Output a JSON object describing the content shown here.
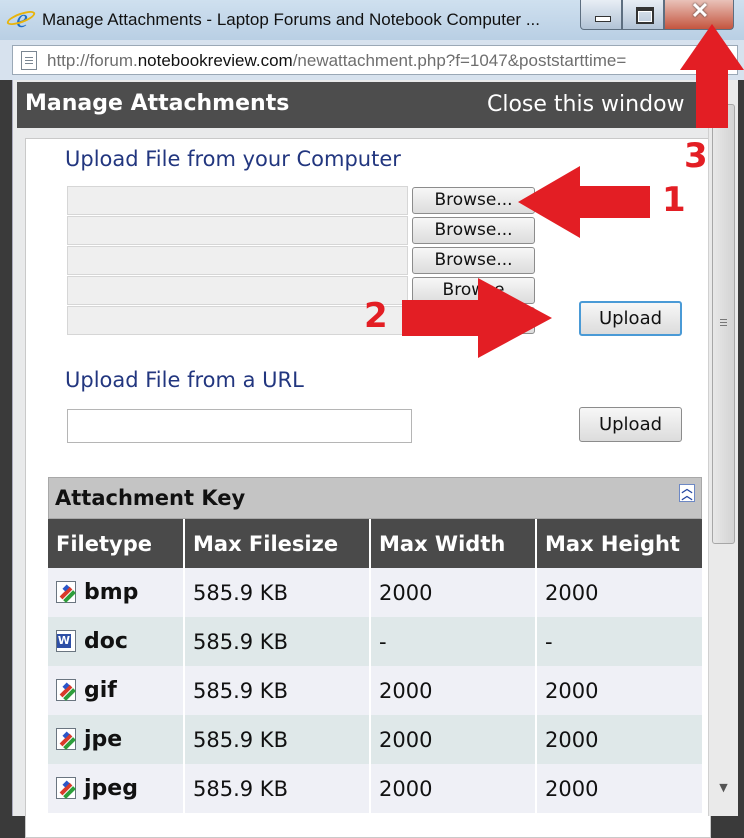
{
  "window": {
    "title": "Manage Attachments - Laptop Forums and Notebook Computer ...",
    "url_prefix": "http://forum.",
    "url_domain": "notebookreview.com",
    "url_suffix": "/newattachment.php?f=1047&poststarttime="
  },
  "header": {
    "title": "Manage Attachments",
    "close_label": "Close this window"
  },
  "upload_computer": {
    "heading": "Upload File from your Computer",
    "browse_label": "Browse...",
    "browse_partial_label": "Browse",
    "upload_label": "Upload"
  },
  "upload_url": {
    "heading": "Upload File from a URL",
    "upload_label": "Upload"
  },
  "attachment_key": {
    "title": "Attachment Key",
    "columns": [
      "Filetype",
      "Max Filesize",
      "Max Width",
      "Max Height"
    ],
    "rows": [
      {
        "icon": "image-file-icon",
        "ext": "bmp",
        "size": "585.9 KB",
        "width": "2000",
        "height": "2000"
      },
      {
        "icon": "word-file-icon",
        "ext": "doc",
        "size": "585.9 KB",
        "width": "-",
        "height": "-"
      },
      {
        "icon": "image-file-icon",
        "ext": "gif",
        "size": "585.9 KB",
        "width": "2000",
        "height": "2000"
      },
      {
        "icon": "image-file-icon",
        "ext": "jpe",
        "size": "585.9 KB",
        "width": "2000",
        "height": "2000"
      },
      {
        "icon": "image-file-icon",
        "ext": "jpeg",
        "size": "585.9 KB",
        "width": "2000",
        "height": "2000"
      }
    ]
  },
  "annotations": {
    "step1": "1",
    "step2": "2",
    "step3": "3",
    "color": "#e31e24"
  },
  "colors": {
    "header_bg": "#4d4d4d",
    "heading_blue": "#22367f",
    "table_header_bg": "#4a4a4a"
  }
}
